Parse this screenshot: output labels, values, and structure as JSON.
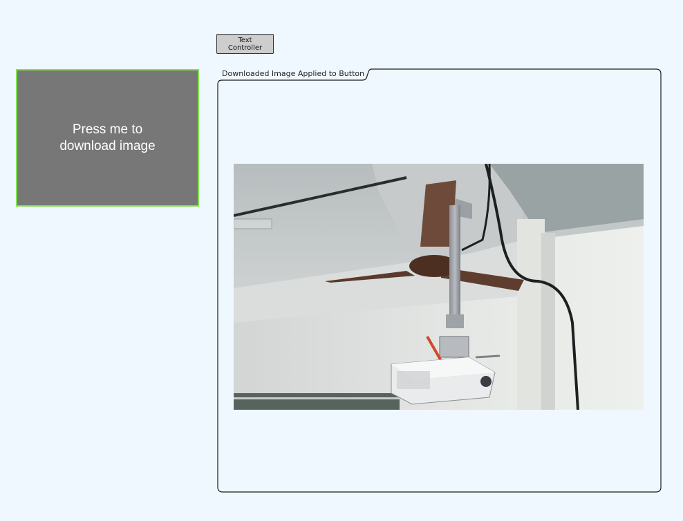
{
  "controls": {
    "text_controller_label": "Text\nController",
    "download_button_label": "Press me to\ndownload image"
  },
  "group": {
    "header": "Downloaded Image Applied to Button"
  },
  "colors": {
    "background": "#f0f8ff",
    "download_button_fill": "#777777",
    "download_button_border": "#7de14a",
    "text_controller_fill": "#cdcdcd"
  },
  "image": {
    "subject": "ceiling-mounted projector with ceiling fan"
  }
}
